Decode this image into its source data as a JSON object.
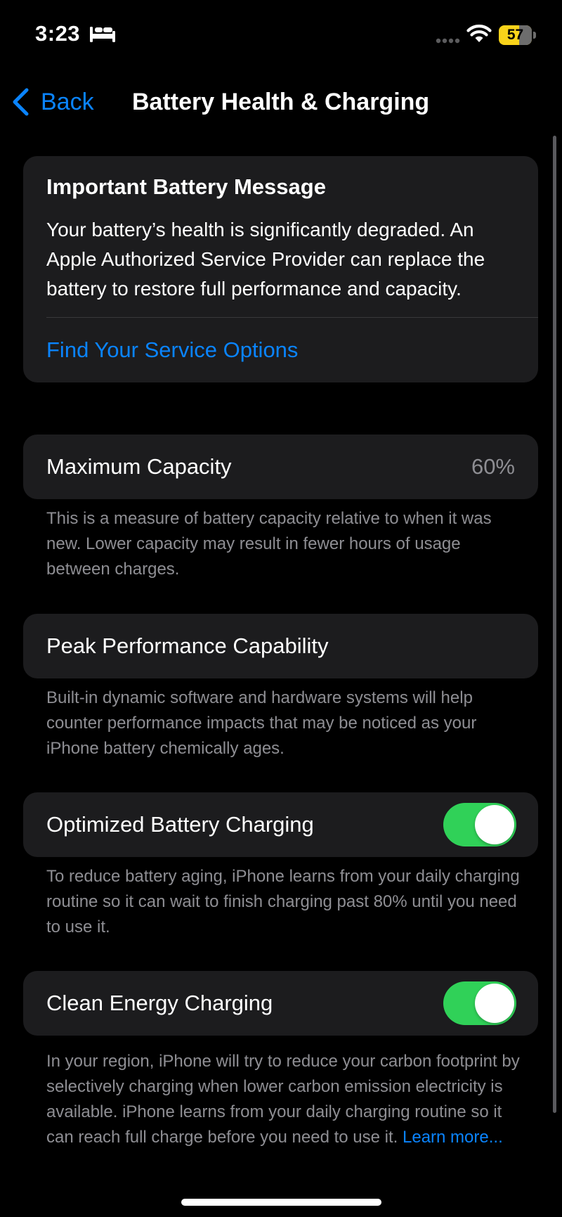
{
  "status_bar": {
    "time": "3:23",
    "focus_icon": "bed-icon",
    "battery_level": "57",
    "battery_color": "#f9d31a"
  },
  "nav": {
    "back_label": "Back",
    "title": "Battery Health & Charging"
  },
  "message": {
    "title": "Important Battery Message",
    "body": "Your battery’s health is significantly degraded. An Apple Authorized Service Provider can replace the battery to restore full performance and capacity.",
    "link": "Find Your Service Options"
  },
  "max_capacity": {
    "label": "Maximum Capacity",
    "value": "60%",
    "footnote": "This is a measure of battery capacity relative to when it was new. Lower capacity may result in fewer hours of usage between charges."
  },
  "peak_performance": {
    "label": "Peak Performance Capability",
    "footnote": "Built-in dynamic software and hardware systems will help counter performance impacts that may be noticed as your iPhone battery chemically ages."
  },
  "optimized_charging": {
    "label": "Optimized Battery Charging",
    "enabled": true,
    "footnote": "To reduce battery aging, iPhone learns from your daily charging routine so it can wait to finish charging past 80% until you need to use it."
  },
  "clean_energy": {
    "label": "Clean Energy Charging",
    "enabled": true,
    "footnote": "In your region, iPhone will try to reduce your carbon footprint by selectively charging when lower carbon emission electricity is available. iPhone learns from your daily charging routine so it can reach full charge before you need to use it.",
    "learn_more": "Learn more..."
  },
  "colors": {
    "accent": "#0a84ff",
    "toggle_on": "#30d158",
    "card_background": "#1c1c1e",
    "secondary_text": "#8e8e93"
  }
}
